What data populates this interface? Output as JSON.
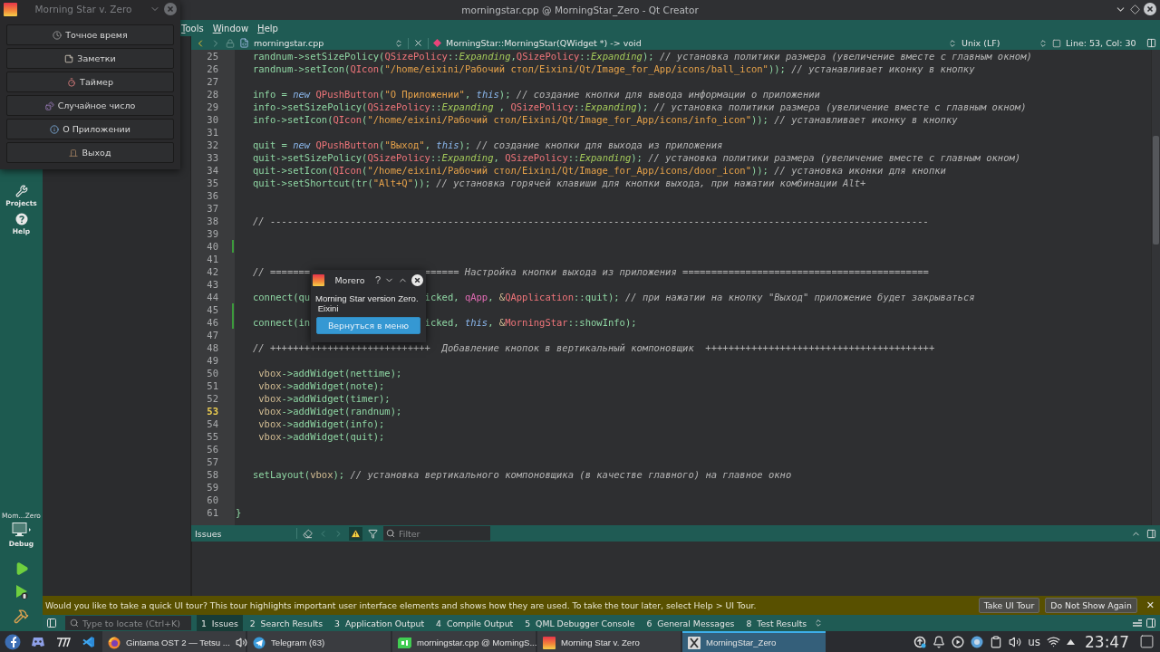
{
  "window": {
    "title": "morningstar.cpp @ MorningStar_Zero - Qt Creator"
  },
  "menu": [
    "Tools",
    "Window",
    "Help"
  ],
  "modes": [
    {
      "label": "Projects",
      "kind": "wrench",
      "selected": false
    },
    {
      "label": "Help",
      "kind": "help",
      "selected": false
    }
  ],
  "kit": {
    "project": "Mom...Zero",
    "config": "Debug"
  },
  "editor": {
    "file": "morningstar.cpp",
    "symbol": "MorningStar::MorningStar(QWidget *) -> void",
    "line_ending": "Unix (LF)",
    "position": "Line: 53, Col: 30",
    "lines": [
      {
        "n": "25",
        "current": false,
        "modified": false,
        "segs": [
          {
            "kind": "f",
            "text": "   randnum->setSizePolicy("
          },
          {
            "kind": "t",
            "text": "QSizePolicy"
          },
          {
            "kind": "f",
            "text": "::"
          },
          {
            "kind": "e",
            "text": "Expanding"
          },
          {
            "kind": "f",
            "text": ","
          },
          {
            "kind": "t",
            "text": "QSizePolicy"
          },
          {
            "kind": "f",
            "text": "::"
          },
          {
            "kind": "e",
            "text": "Expanding"
          },
          {
            "kind": "f",
            "text": "); "
          },
          {
            "kind": "c",
            "text": "// установка политики размера (увеличение вместе с главным окном)"
          }
        ]
      },
      {
        "n": "26",
        "current": false,
        "modified": false,
        "segs": [
          {
            "kind": "f",
            "text": "   randnum->setIcon("
          },
          {
            "kind": "t",
            "text": "QIcon"
          },
          {
            "kind": "f",
            "text": "("
          },
          {
            "kind": "s",
            "text": "\"/home/eixini/Рабочий стол/Eixini/Qt/Image_for_App/icons/ball_icon\""
          },
          {
            "kind": "f",
            "text": ")); "
          },
          {
            "kind": "c",
            "text": "// устанавливает иконку в кнопку"
          }
        ]
      },
      {
        "n": "27",
        "current": false,
        "modified": false
      },
      {
        "n": "28",
        "current": false,
        "modified": false,
        "segs": [
          {
            "kind": "f",
            "text": "   info = "
          },
          {
            "kind": "k",
            "text": "new "
          },
          {
            "kind": "t",
            "text": "QPushButton"
          },
          {
            "kind": "f",
            "text": "("
          },
          {
            "kind": "s",
            "text": "\"О Приложении\""
          },
          {
            "kind": "f",
            "text": ", "
          },
          {
            "kind": "k",
            "text": "this"
          },
          {
            "kind": "f",
            "text": "); "
          },
          {
            "kind": "c",
            "text": "// создание кнопки для вывода информации о приложении"
          }
        ]
      },
      {
        "n": "29",
        "current": false,
        "modified": false,
        "segs": [
          {
            "kind": "f",
            "text": "   info->setSizePolicy("
          },
          {
            "kind": "t",
            "text": "QSizePolicy"
          },
          {
            "kind": "f",
            "text": "::"
          },
          {
            "kind": "e",
            "text": "Expanding"
          },
          {
            "kind": "f",
            "text": " , "
          },
          {
            "kind": "t",
            "text": "QSizePolicy"
          },
          {
            "kind": "f",
            "text": "::"
          },
          {
            "kind": "e",
            "text": "Expanding"
          },
          {
            "kind": "f",
            "text": "); "
          },
          {
            "kind": "c",
            "text": "// установка политики размера (увеличение вместе с главным окном)"
          }
        ]
      },
      {
        "n": "30",
        "current": false,
        "modified": false,
        "segs": [
          {
            "kind": "f",
            "text": "   info->setIcon("
          },
          {
            "kind": "t",
            "text": "QIcon"
          },
          {
            "kind": "f",
            "text": "("
          },
          {
            "kind": "s",
            "text": "\"/home/eixini/Рабочий стол/Eixini/Qt/Image_for_App/icons/info_icon\""
          },
          {
            "kind": "f",
            "text": ")); "
          },
          {
            "kind": "c",
            "text": "// устанавливает иконку в кнопку"
          }
        ]
      },
      {
        "n": "31",
        "current": false,
        "modified": false
      },
      {
        "n": "32",
        "current": false,
        "modified": false,
        "segs": [
          {
            "kind": "f",
            "text": "   quit = "
          },
          {
            "kind": "k",
            "text": "new "
          },
          {
            "kind": "t",
            "text": "QPushButton"
          },
          {
            "kind": "f",
            "text": "("
          },
          {
            "kind": "s",
            "text": "\"Выход\""
          },
          {
            "kind": "f",
            "text": ", "
          },
          {
            "kind": "k",
            "text": "this"
          },
          {
            "kind": "f",
            "text": "); "
          },
          {
            "kind": "c",
            "text": "// создание кнопки для выхода из приложения"
          }
        ]
      },
      {
        "n": "33",
        "current": false,
        "modified": false,
        "segs": [
          {
            "kind": "f",
            "text": "   quit->setSizePolicy("
          },
          {
            "kind": "t",
            "text": "QSizePolicy"
          },
          {
            "kind": "f",
            "text": "::"
          },
          {
            "kind": "e",
            "text": "Expanding"
          },
          {
            "kind": "f",
            "text": ", "
          },
          {
            "kind": "t",
            "text": "QSizePolicy"
          },
          {
            "kind": "f",
            "text": "::"
          },
          {
            "kind": "e",
            "text": "Expanding"
          },
          {
            "kind": "f",
            "text": "); "
          },
          {
            "kind": "c",
            "text": "// установка политики размера (увеличение вместе с главным окном)"
          }
        ]
      },
      {
        "n": "34",
        "current": false,
        "modified": false,
        "segs": [
          {
            "kind": "f",
            "text": "   quit->setIcon("
          },
          {
            "kind": "t",
            "text": "QIcon"
          },
          {
            "kind": "f",
            "text": "("
          },
          {
            "kind": "s",
            "text": "\"/home/eixini/Рабочий стол/Eixini/Qt/Image_for_App/icons/door_icon\""
          },
          {
            "kind": "f",
            "text": ")); "
          },
          {
            "kind": "c",
            "text": "// установка иконки для кнопки"
          }
        ]
      },
      {
        "n": "35",
        "current": false,
        "modified": false,
        "segs": [
          {
            "kind": "f",
            "text": "   quit->setShortcut(tr("
          },
          {
            "kind": "s",
            "text": "\"Alt+Q\""
          },
          {
            "kind": "f",
            "text": ")); "
          },
          {
            "kind": "c",
            "text": "// установка горячей клавиши для кнопки выхода, при нажатии комбинации Alt+"
          }
        ]
      },
      {
        "n": "36",
        "current": false,
        "modified": false
      },
      {
        "n": "37",
        "current": false,
        "modified": false
      },
      {
        "n": "38",
        "current": false,
        "modified": false,
        "segs": [
          {
            "kind": "c",
            "text": "   // -------------------------------------------------------------------------------------------------------------------"
          }
        ]
      },
      {
        "n": "39",
        "current": false,
        "modified": false
      },
      {
        "n": "40",
        "current": false,
        "modified": true
      },
      {
        "n": "41",
        "current": false,
        "modified": false
      },
      {
        "n": "42",
        "current": false,
        "modified": false,
        "segs": [
          {
            "kind": "c",
            "text": "   // ======="
          },
          {
            "kind": "covered"
          },
          {
            "kind": "c",
            "text": "====== Настройка кнопки выхода из приложения ==========================================="
          }
        ]
      },
      {
        "n": "43",
        "current": false,
        "modified": false
      },
      {
        "n": "44",
        "current": false,
        "modified": false,
        "segs": [
          {
            "kind": "f",
            "text": "   connect(qu"
          },
          {
            "kind": "covered"
          },
          {
            "kind": "f",
            "text": "icked, "
          },
          {
            "kind": "g",
            "text": "qApp"
          },
          {
            "kind": "f",
            "text": ", "
          },
          {
            "kind": "v",
            "text": "&"
          },
          {
            "kind": "t",
            "text": "QApplication"
          },
          {
            "kind": "f",
            "text": "::quit); "
          },
          {
            "kind": "c",
            "text": "// при нажатии на кнопку \"Выход\" приложение будет закрываться"
          }
        ]
      },
      {
        "n": "45",
        "current": false,
        "modified": true
      },
      {
        "n": "46",
        "current": false,
        "modified": true,
        "segs": [
          {
            "kind": "f",
            "text": "   connect(in"
          },
          {
            "kind": "covered"
          },
          {
            "kind": "f",
            "text": "icked, "
          },
          {
            "kind": "k",
            "text": "this"
          },
          {
            "kind": "f",
            "text": ", "
          },
          {
            "kind": "v",
            "text": "&"
          },
          {
            "kind": "t",
            "text": "MorningStar"
          },
          {
            "kind": "f",
            "text": "::showInfo);"
          }
        ]
      },
      {
        "n": "47",
        "current": false,
        "modified": false
      },
      {
        "n": "48",
        "current": false,
        "modified": false,
        "segs": [
          {
            "kind": "c",
            "text": "   // ++++++++++++++++++++++++++++  Добавление кнопок в вертикальный компоновщик  ++++++++++++++++++++++++++++++++++++++++"
          }
        ]
      },
      {
        "n": "49",
        "current": false,
        "modified": false
      },
      {
        "n": "50",
        "current": false,
        "modified": false,
        "segs": [
          {
            "kind": "v",
            "text": "    vbox"
          },
          {
            "kind": "f",
            "text": "->addWidget(nettime);"
          }
        ]
      },
      {
        "n": "51",
        "current": false,
        "modified": false,
        "segs": [
          {
            "kind": "v",
            "text": "    vbox"
          },
          {
            "kind": "f",
            "text": "->addWidget(note);"
          }
        ]
      },
      {
        "n": "52",
        "current": false,
        "modified": false,
        "segs": [
          {
            "kind": "v",
            "text": "    vbox"
          },
          {
            "kind": "f",
            "text": "->addWidget(timer);"
          }
        ]
      },
      {
        "n": "53",
        "current": true,
        "modified": false,
        "segs": [
          {
            "kind": "v",
            "text": "    vbox"
          },
          {
            "kind": "f",
            "text": "->addWidget(randnum);"
          }
        ]
      },
      {
        "n": "54",
        "current": false,
        "modified": false,
        "segs": [
          {
            "kind": "v",
            "text": "    vbox"
          },
          {
            "kind": "f",
            "text": "->addWidget(info);"
          }
        ]
      },
      {
        "n": "55",
        "current": false,
        "modified": false,
        "segs": [
          {
            "kind": "v",
            "text": "    vbox"
          },
          {
            "kind": "f",
            "text": "->addWidget(quit);"
          }
        ]
      },
      {
        "n": "56",
        "current": false,
        "modified": false
      },
      {
        "n": "57",
        "current": false,
        "modified": false
      },
      {
        "n": "58",
        "current": false,
        "modified": false,
        "segs": [
          {
            "kind": "f",
            "text": "   setLayout("
          },
          {
            "kind": "v",
            "text": "vbox"
          },
          {
            "kind": "f",
            "text": "); "
          },
          {
            "kind": "c",
            "text": "// установка вертикального компоновщика (в качестве главного) на главное окно"
          }
        ]
      },
      {
        "n": "59",
        "current": false,
        "modified": false
      },
      {
        "n": "60",
        "current": false,
        "modified": false
      },
      {
        "n": "61",
        "current": false,
        "modified": false,
        "segs": [
          {
            "kind": "f",
            "text": "}"
          }
        ]
      }
    ]
  },
  "issues": {
    "title": "Issues",
    "filter": {
      "placeholder": "Filter"
    }
  },
  "tour": {
    "text": "Would you like to take a quick UI tour? This tour highlights important user interface elements and shows how they are used. To take the tour later, select Help > UI Tour.",
    "buttons": [
      "Take UI Tour",
      "Do Not Show Again"
    ],
    "close": "✕"
  },
  "output": {
    "locate": {
      "placeholder": "Type to locate (Ctrl+K)"
    },
    "tabs": [
      {
        "number": "1",
        "label": "Issues",
        "selected": true
      },
      {
        "number": "2",
        "label": "Search Results",
        "selected": false
      },
      {
        "number": "3",
        "label": "Application Output",
        "selected": false
      },
      {
        "number": "4",
        "label": "Compile Output",
        "selected": false
      },
      {
        "number": "5",
        "label": "QML Debugger Console",
        "selected": false
      },
      {
        "number": "6",
        "label": "General Messages",
        "selected": false
      },
      {
        "number": "8",
        "label": "Test Results",
        "selected": false
      }
    ]
  },
  "taskbar": {
    "tasks": [
      {
        "label": "Gintama OST 2 — Tetsu ...",
        "kind": "browser",
        "playing": true,
        "selected": false
      },
      {
        "label": "Telegram (63)",
        "kind": "messenger",
        "playing": false,
        "selected": false
      },
      {
        "label": "morningstar.cpp @ MorningS...",
        "kind": "ide",
        "playing": false,
        "selected": false
      },
      {
        "label": "Morning Star v. Zero",
        "kind": "app",
        "playing": false,
        "selected": false
      },
      {
        "label": "MorningStar_Zero",
        "kind": "x11",
        "playing": false,
        "selected": true
      }
    ],
    "keyboard_layout": "us",
    "clock": "23:47"
  },
  "app_window": {
    "title": "Morning Star v. Zero",
    "buttons": [
      {
        "label": "Точное время",
        "kind": "clock"
      },
      {
        "label": "Заметки",
        "kind": "note"
      },
      {
        "label": "Таймер",
        "kind": "timer"
      },
      {
        "label": "Случайное число",
        "kind": "dice"
      },
      {
        "label": "О Приложении",
        "kind": "info"
      },
      {
        "label": "Выход",
        "kind": "door"
      }
    ]
  },
  "dialog": {
    "title": "Morero",
    "help": "?",
    "message": "Morning Star version Zero.\n Eixini",
    "button": "Вернуться в меню"
  }
}
